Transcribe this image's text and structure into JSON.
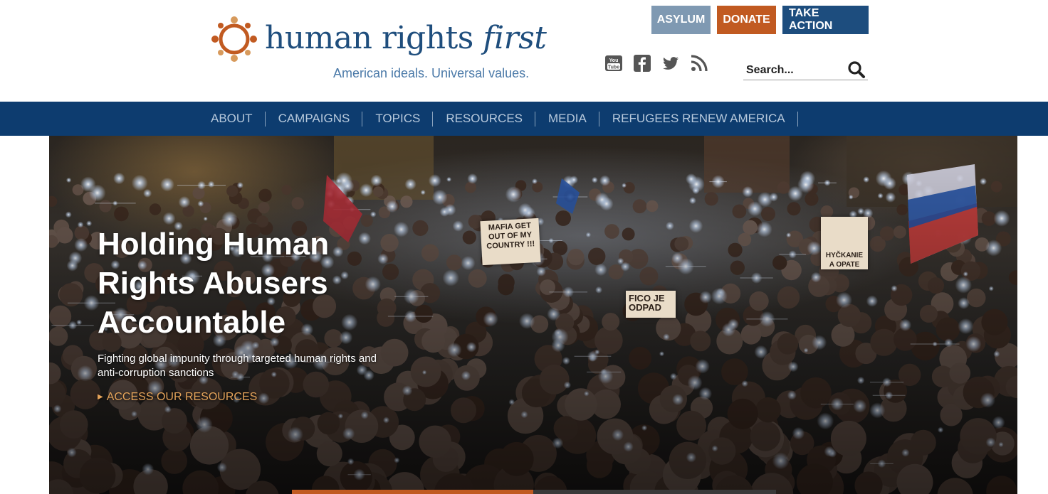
{
  "brand": {
    "name_part1": "human rights ",
    "name_part2": "first",
    "tagline": "American ideals. Universal values.",
    "colors": {
      "primary": "#1d4d7e",
      "accent": "#c15a21",
      "logo_orange": "#c15a21",
      "logo_tan": "#d79a5c"
    }
  },
  "top_buttons": [
    {
      "label": "ASYLUM",
      "color": "#7f99b2"
    },
    {
      "label": "DONATE",
      "color": "#c15a21"
    },
    {
      "label": "TAKE ACTION",
      "color": "#1d4d7e"
    }
  ],
  "social": [
    {
      "icon": "youtube-icon"
    },
    {
      "icon": "facebook-icon"
    },
    {
      "icon": "twitter-icon"
    },
    {
      "icon": "rss-icon"
    }
  ],
  "search": {
    "placeholder": "Search...",
    "icon": "search-icon"
  },
  "nav": {
    "items": [
      "ABOUT",
      "CAMPAIGNS",
      "TOPICS",
      "RESOURCES",
      "MEDIA",
      "REFUGEES RENEW AMERICA"
    ]
  },
  "hero": {
    "title": "Holding Human Rights Abusers Accountable",
    "subtitle": "Fighting global impunity through targeted human rights and anti-corruption sanctions",
    "link": "ACCESS OUR RESOURCES",
    "signs": {
      "mafia": "MAFIA GET OUT OF MY COUNTRY !!!",
      "fico": "FICO JE ODPAD",
      "poster": "HYČKANIE A OPATE"
    }
  }
}
